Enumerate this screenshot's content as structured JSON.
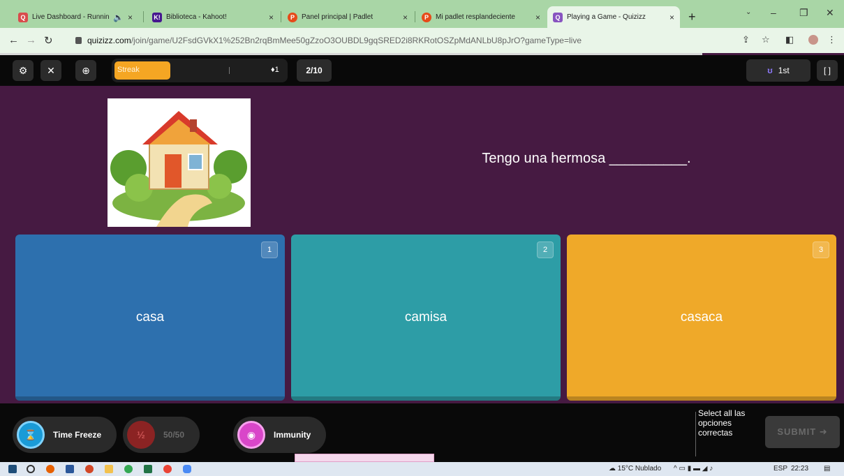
{
  "browser": {
    "tabs": [
      {
        "title": "Live Dashboard - Runnin",
        "extra": "🔈",
        "color": "#d94c4c",
        "glyph": "Q"
      },
      {
        "title": "Biblioteca - Kahoot!",
        "color": "#46178f",
        "glyph": "K!"
      },
      {
        "title": "Panel principal | Padlet",
        "color": "#e64a19",
        "glyph": "P"
      },
      {
        "title": "Mi padlet resplandeciente",
        "color": "#e64a19",
        "glyph": "P"
      },
      {
        "title": "Playing a Game - Quizizz",
        "color": "#8854c0",
        "glyph": "Q"
      }
    ],
    "new_tab": "+",
    "url_host": "quizizz.com",
    "url_rest": "/join/game/U2FsdGVkX1%252Bn2rqBmMee50gZzoO3OUBDL9gqSRED2i8RKRotOSZpMdANLbU8pJrO?gameType=live"
  },
  "game": {
    "streak_label": "Streak",
    "streak_count": "♦1",
    "question_counter": "2/10",
    "rank": "1st",
    "question_text": "Tengo una hermosa __________.",
    "options": [
      {
        "num": "1",
        "text": "casa",
        "color": "#2d70ae"
      },
      {
        "num": "2",
        "text": "camisa",
        "color": "#2d9da6"
      },
      {
        "num": "3",
        "text": "casaca",
        "color": "#efa929"
      }
    ],
    "powerups": [
      {
        "label": "Time Freeze",
        "color": "#1a9bd7"
      },
      {
        "label": "50/50",
        "color": "#8b2323"
      },
      {
        "label": "Immunity",
        "color": "#d946c9"
      }
    ],
    "hint": "Select all las opciones correctas",
    "submit_label": "SUBMIT ➜"
  },
  "taskbar": {
    "weather": "15°C Nublado",
    "lang": "ESP",
    "time": "22:23"
  }
}
